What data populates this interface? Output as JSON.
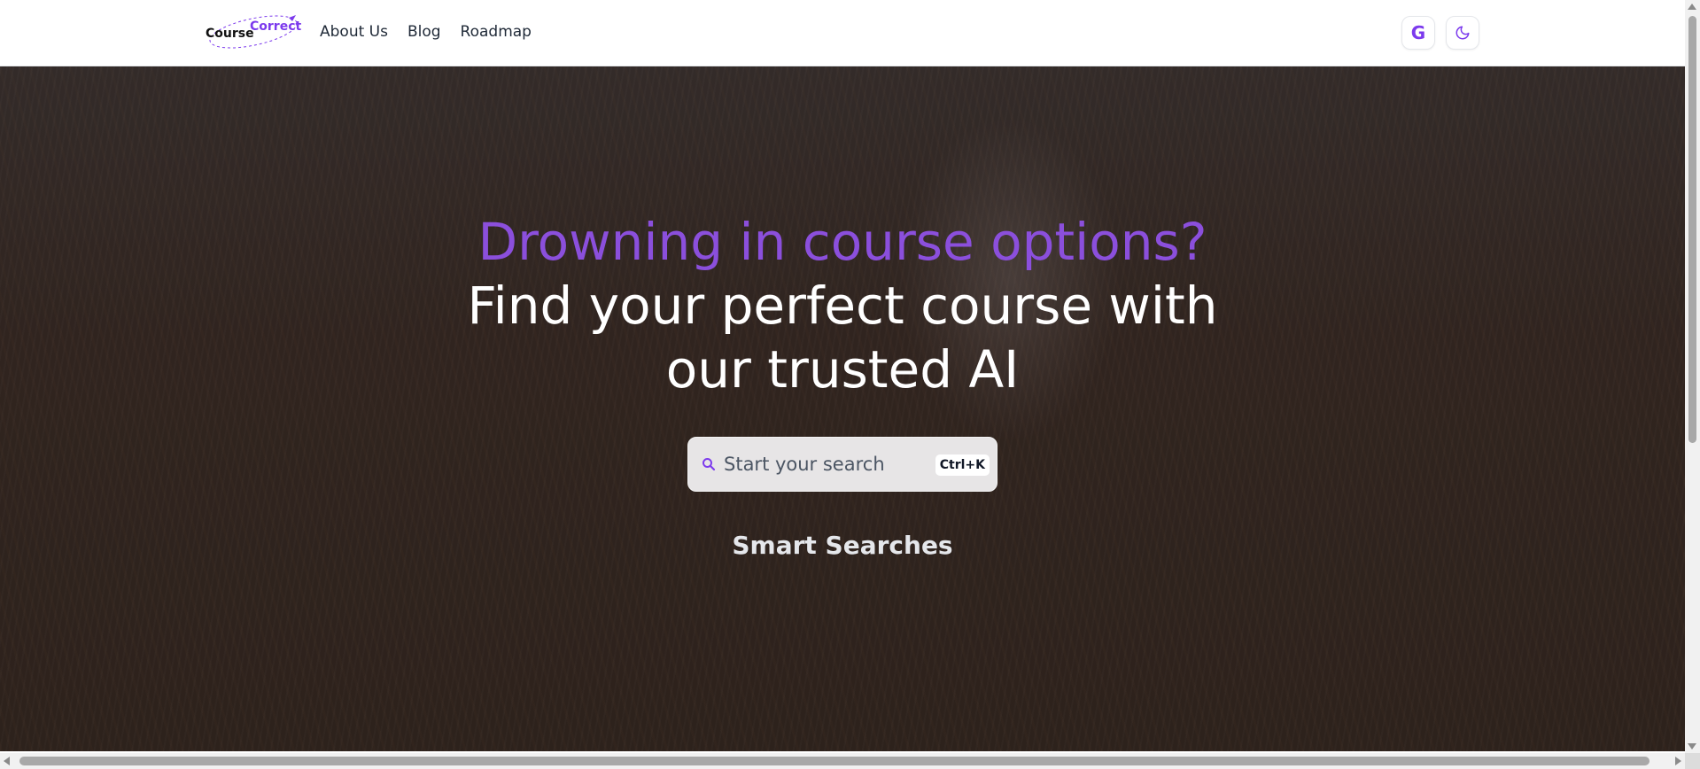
{
  "logo": {
    "part1": "Course",
    "part2": "Correct"
  },
  "nav": {
    "items": [
      {
        "label": "About Us"
      },
      {
        "label": "Blog"
      },
      {
        "label": "Roadmap"
      }
    ]
  },
  "header_buttons": {
    "google_glyph": "G",
    "google_icon": "google-icon",
    "theme_icon": "moon-icon"
  },
  "hero": {
    "headline_accent": "Drowning in course options?",
    "headline_line1": "Find your perfect course with",
    "headline_line2": "our trusted AI",
    "search_placeholder": "Start your search",
    "search_shortcut": "Ctrl+K",
    "smart_searches_label": "Smart Searches"
  },
  "colors": {
    "accent": "#8b4fdc",
    "headline": "#ffffff",
    "hero_overlay": "#2f2521"
  }
}
